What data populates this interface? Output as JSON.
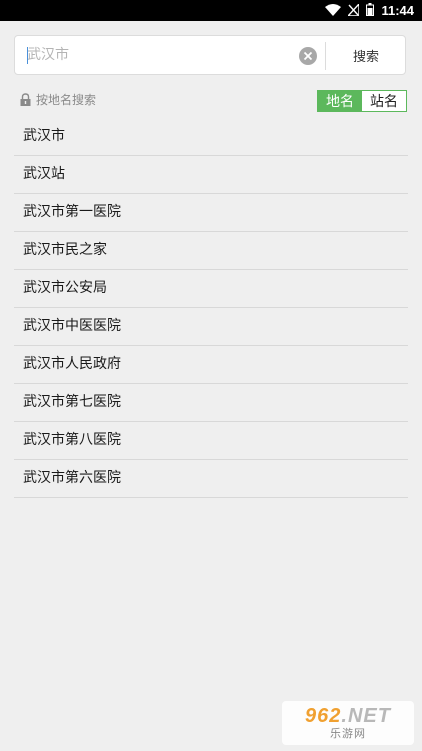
{
  "status_bar": {
    "time": "11:44"
  },
  "search": {
    "value": "",
    "placeholder": "武汉市",
    "button_label": "搜索"
  },
  "mode": {
    "label": "按地名搜索",
    "options": [
      {
        "label": "地名",
        "selected": true
      },
      {
        "label": "站名",
        "selected": false
      }
    ]
  },
  "results": [
    "武汉市",
    "武汉站",
    "武汉市第一医院",
    "武汉市民之家",
    "武汉市公安局",
    "武汉市中医医院",
    "武汉市人民政府",
    "武汉市第七医院",
    "武汉市第八医院",
    "武汉市第六医院"
  ],
  "watermark": {
    "top": "962",
    "net": ".NET",
    "bottom": "乐游网"
  },
  "colors": {
    "accent": "#5cb85c",
    "status_bar": "#000000",
    "background": "#efefef"
  }
}
